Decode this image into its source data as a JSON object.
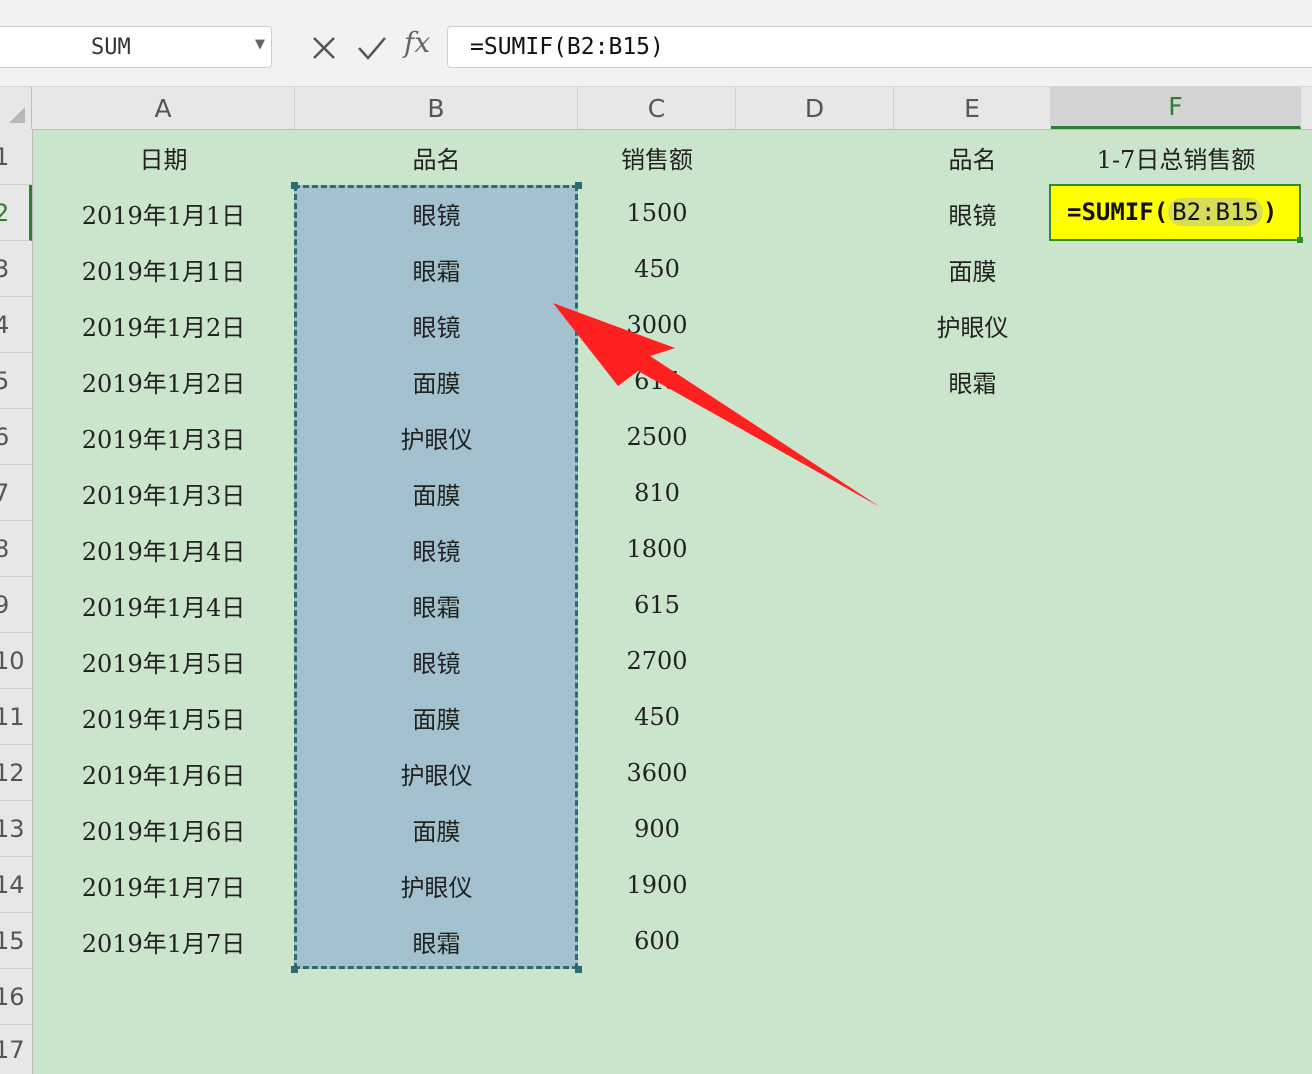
{
  "name_box": {
    "value": "SUM"
  },
  "formula_bar": {
    "cancel_icon": "x-icon",
    "enter_icon": "check-icon",
    "fx_label": "fx",
    "formula": "=SUMIF(B2:B15)"
  },
  "columns": [
    "A",
    "B",
    "C",
    "D",
    "E",
    "F"
  ],
  "rows": [
    "1",
    "2",
    "3",
    "4",
    "5",
    "6",
    "7",
    "8",
    "9",
    "10",
    "11",
    "12",
    "13",
    "14",
    "15",
    "16",
    "17"
  ],
  "headers": {
    "date": "日期",
    "product": "品名",
    "sales": "销售额",
    "e_product": "品名",
    "f_total": "1-7日总销售额"
  },
  "data_rows": [
    {
      "date": "2019年1月1日",
      "product": "眼镜",
      "sales": "1500"
    },
    {
      "date": "2019年1月1日",
      "product": "眼霜",
      "sales": "450"
    },
    {
      "date": "2019年1月2日",
      "product": "眼镜",
      "sales": "3000"
    },
    {
      "date": "2019年1月2日",
      "product": "面膜",
      "sales": "615"
    },
    {
      "date": "2019年1月3日",
      "product": "护眼仪",
      "sales": "2500"
    },
    {
      "date": "2019年1月3日",
      "product": "面膜",
      "sales": "810"
    },
    {
      "date": "2019年1月4日",
      "product": "眼镜",
      "sales": "1800"
    },
    {
      "date": "2019年1月4日",
      "product": "眼霜",
      "sales": "615"
    },
    {
      "date": "2019年1月5日",
      "product": "眼镜",
      "sales": "2700"
    },
    {
      "date": "2019年1月5日",
      "product": "面膜",
      "sales": "450"
    },
    {
      "date": "2019年1月6日",
      "product": "护眼仪",
      "sales": "3600"
    },
    {
      "date": "2019年1月6日",
      "product": "面膜",
      "sales": "900"
    },
    {
      "date": "2019年1月7日",
      "product": "护眼仪",
      "sales": "1900"
    },
    {
      "date": "2019年1月7日",
      "product": "眼霜",
      "sales": "600"
    }
  ],
  "e_items": [
    "眼镜",
    "面膜",
    "护眼仪",
    "眼霜"
  ],
  "active_cell": {
    "prefix": "=SUMIF(",
    "ref": "B2:B15",
    "suffix": ")"
  },
  "colors": {
    "sheet_bg": "#cbe5cd",
    "selection": "#a4c1cf",
    "active_cell": "#ffff00",
    "arrow": "#ff2020",
    "accent": "#2e7d32"
  }
}
